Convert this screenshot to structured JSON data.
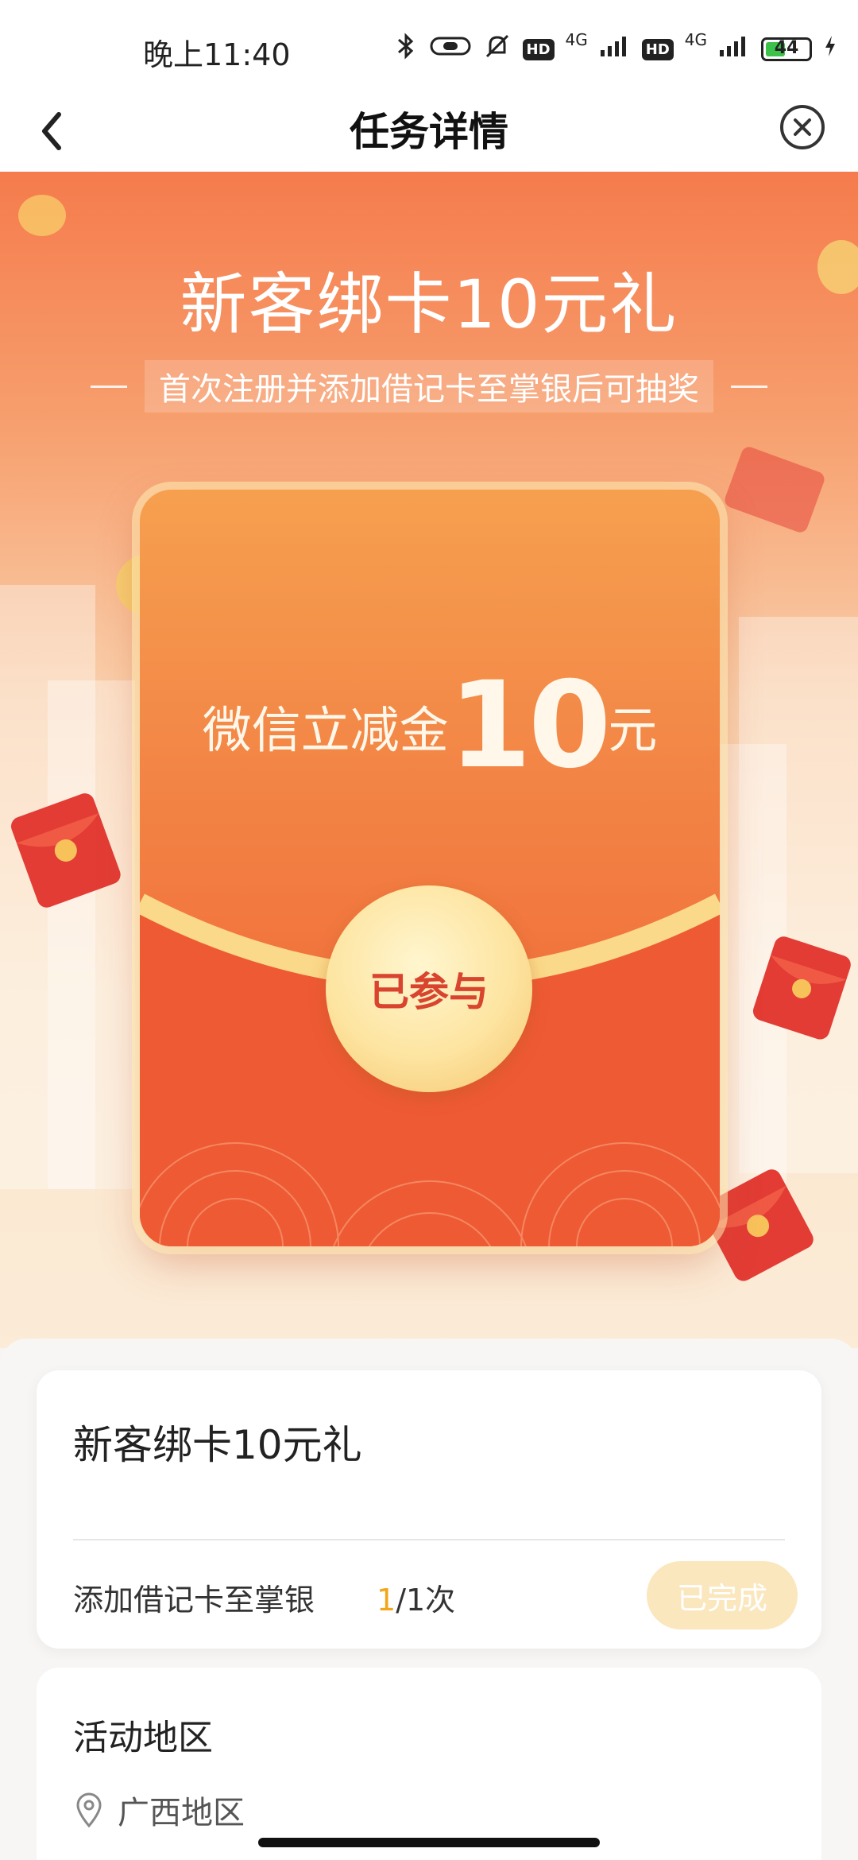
{
  "status_bar": {
    "time": "晚上11:40",
    "network": "4G",
    "hd_label": "HD",
    "battery": "44"
  },
  "nav": {
    "title": "任务详情",
    "back_icon": "chevron-left-icon",
    "close_icon": "close-circle-icon"
  },
  "hero": {
    "title": "新客绑卡10元礼",
    "subtitle": "首次注册并添加借记卡至掌银后可抽奖",
    "red_packet": {
      "prefix": "微信立减金",
      "amount": "10",
      "unit": "元",
      "button": "已参与"
    }
  },
  "task": {
    "title": "新客绑卡10元礼",
    "row_label": "添加借记卡至掌银",
    "progress_done": "1",
    "progress_rest": "/1次",
    "status_button": "已完成"
  },
  "region": {
    "title": "活动地区",
    "value": "广西地区",
    "icon": "location-pin-icon"
  },
  "colors": {
    "accent_orange": "#f2a71b",
    "hero_top": "#f57b4c",
    "red_packet": "#ef5b35",
    "button_text": "#d8442e"
  }
}
